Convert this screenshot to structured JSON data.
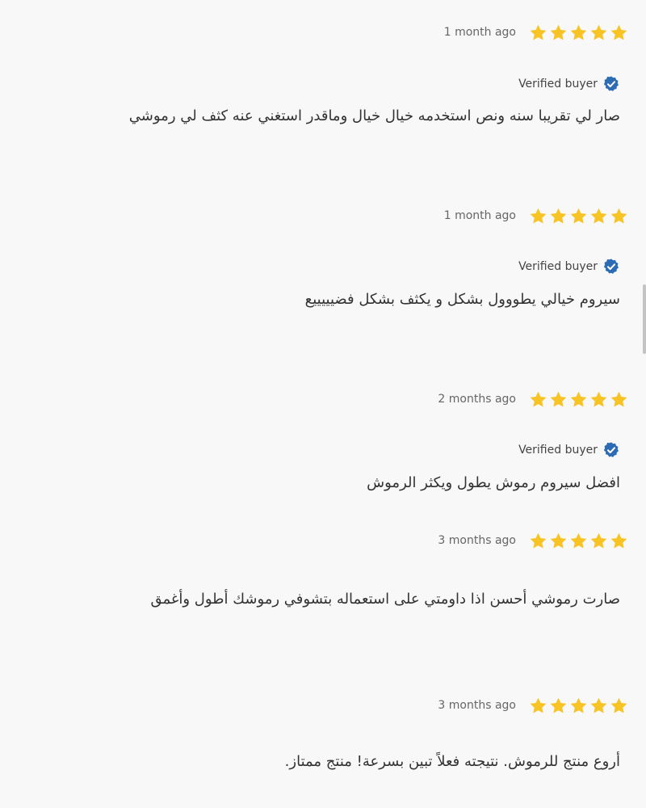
{
  "colors": {
    "star": "#F7C325",
    "verified_badge": "#2D6CB5",
    "background": "#F8F8F8"
  },
  "reviews": [
    {
      "date": "1 month ago",
      "rating": 5,
      "verified_label": "Verified buyer",
      "text": "صار لي تقريبا سنه ونص استخدمه خيال خيال وماقدر استغني عنه كثف لي رموشي"
    },
    {
      "date": "1 month ago",
      "rating": 5,
      "verified_label": "Verified buyer",
      "text": "سيروم خيالي يطووول بشكل و يكثف بشكل فضيييييع"
    },
    {
      "date": "2 months ago",
      "rating": 5,
      "verified_label": "Verified buyer",
      "text": "افضل سيروم رموش يطول ويكثر الرموش"
    },
    {
      "date": "3 months ago",
      "rating": 5,
      "text": "صارت رموشي أحسن اذا داومتي على استعماله بتشوفي رموشك أطول وأغمق"
    },
    {
      "date": "3 months ago",
      "rating": 5,
      "text": "أروع منتج للرموش. نتيجته فعلاً تبين بسرعة! منتج ممتاز."
    }
  ]
}
